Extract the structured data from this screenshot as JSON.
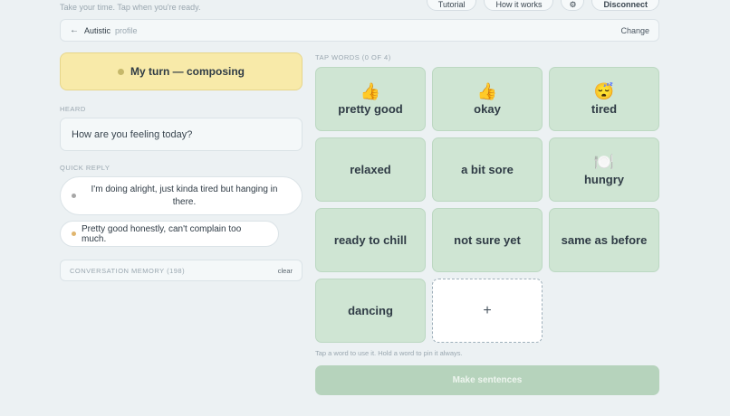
{
  "tagline": "Take your time. Tap when you're ready.",
  "top_actions": {
    "tutorial": "Tutorial",
    "how_it_works": "How it works",
    "settings_icon": "gear-icon",
    "disconnect": "Disconnect"
  },
  "profile": {
    "back_icon": "←",
    "name": "Autistic",
    "suffix": "profile",
    "change": "Change"
  },
  "status": {
    "label": "My turn — composing",
    "dot_color": "#c6b86a"
  },
  "heard": {
    "label": "HEARD",
    "text": "How are you feeling today?"
  },
  "quick_reply": {
    "label": "QUICK REPLY",
    "replies": [
      {
        "text": "I'm doing alright, just kinda tired but hanging in there.",
        "dot_color": "#a7a7a7"
      },
      {
        "text": "Pretty good honestly, can't complain too much.",
        "dot_color": "#e0b56e"
      }
    ]
  },
  "memory": {
    "label": "CONVERSATION MEMORY (198)",
    "clear": "clear"
  },
  "tap_words": {
    "label": "TAP WORDS (0 OF 4)",
    "tiles": [
      {
        "emoji": "👍",
        "word": "pretty good"
      },
      {
        "emoji": "👍",
        "word": "okay"
      },
      {
        "emoji": "😴",
        "word": "tired"
      },
      {
        "emoji": "",
        "word": "relaxed"
      },
      {
        "emoji": "",
        "word": "a bit sore"
      },
      {
        "emoji": "🍽️",
        "word": "hungry"
      },
      {
        "emoji": "",
        "word": "ready to chill"
      },
      {
        "emoji": "",
        "word": "not sure yet"
      },
      {
        "emoji": "",
        "word": "same as before"
      },
      {
        "emoji": "",
        "word": "dancing"
      }
    ],
    "add_label": "+"
  },
  "hint": "Tap a word to use it. Hold a word to pin it always.",
  "make_button": "Make sentences",
  "colors": {
    "background": "#ecf1f3",
    "tile": "#cfe5d3",
    "status": "#f8eaa9",
    "make_button": "#b6d3bc"
  }
}
